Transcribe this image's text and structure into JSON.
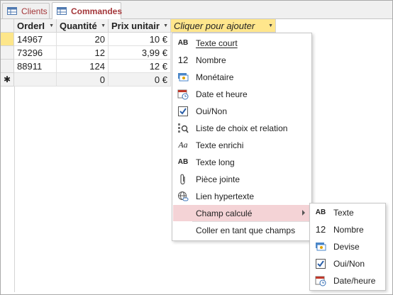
{
  "tabs": [
    {
      "label": "Clients"
    },
    {
      "label": "Commandes"
    }
  ],
  "columns": [
    {
      "label": "OrderI"
    },
    {
      "label": "Quantité"
    },
    {
      "label": "Prix unitair"
    },
    {
      "label": "Cliquer pour ajouter"
    }
  ],
  "rows": [
    {
      "order": "14967",
      "qty": "20",
      "price": "10 €"
    },
    {
      "order": "73296",
      "qty": "12",
      "price": "3,99 €"
    },
    {
      "order": "88911",
      "qty": "124",
      "price": "12 €"
    }
  ],
  "new_row": {
    "marker": "✱",
    "qty": "0",
    "price": "0 €"
  },
  "menu": [
    {
      "icon": "AB",
      "label": "Texte court"
    },
    {
      "icon": "12",
      "label": "Nombre"
    },
    {
      "icon": "currency-icon",
      "label": "Monétaire"
    },
    {
      "icon": "calendar-icon",
      "label": "Date et heure"
    },
    {
      "icon": "checkbox-icon",
      "label": "Oui/Non"
    },
    {
      "icon": "lookup-icon",
      "label": "Liste de choix et relation"
    },
    {
      "icon": "Aa",
      "label": "Texte enrichi"
    },
    {
      "icon": "AB",
      "label": "Texte long"
    },
    {
      "icon": "paperclip-icon",
      "label": "Pièce jointe"
    },
    {
      "icon": "hyperlink-icon",
      "label": "Lien hypertexte"
    },
    {
      "icon": "",
      "label": "Champ calculé"
    },
    {
      "icon": "",
      "label": "Coller en tant que champs"
    }
  ],
  "submenu": [
    {
      "icon": "AB",
      "label": "Texte"
    },
    {
      "icon": "12",
      "label": "Nombre"
    },
    {
      "icon": "currency-icon",
      "label": "Devise"
    },
    {
      "icon": "checkbox-icon",
      "label": "Oui/Non"
    },
    {
      "icon": "calendar-icon",
      "label": "Date/heure"
    }
  ],
  "colors": {
    "accent": "#a4373a",
    "highlight": "#f4d3d6",
    "add_column": "#ffe68c",
    "selected_row": "#fde68a"
  }
}
